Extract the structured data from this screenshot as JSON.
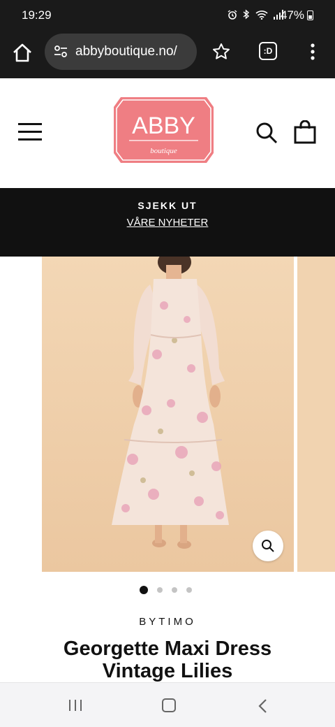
{
  "status_bar": {
    "time": "19:29",
    "battery": "47%"
  },
  "browser": {
    "url": "abbyboutique.no/",
    "tab_label": ":D"
  },
  "header": {
    "logo_text": "ABBY",
    "logo_subtext": "boutique"
  },
  "announcement": {
    "title": "SJEKK UT",
    "link": "VÅRE NYHETER"
  },
  "product": {
    "brand": "BYTIMO",
    "title": "Georgette Maxi Dress Vintage Lilies",
    "gallery_count": 4,
    "gallery_active": 1
  },
  "colors": {
    "logo_pink": "#ef7e83",
    "announce_bg": "#111111",
    "photo_bg": "#f0d0ac"
  }
}
